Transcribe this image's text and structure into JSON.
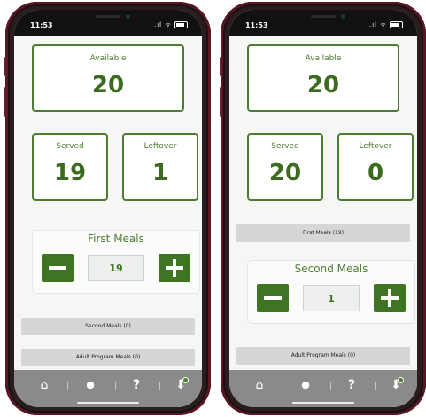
{
  "status_bar": {
    "time": "11:53",
    "signal": ".ıl",
    "wifi": "ᯤ"
  },
  "left_phone": {
    "available": {
      "label": "Available",
      "value": "20"
    },
    "served": {
      "label": "Served",
      "value": "19"
    },
    "leftover": {
      "label": "Leftover",
      "value": "1"
    },
    "meal_stepper": {
      "title": "First Meals",
      "count": "19",
      "minus": "−",
      "plus": "+"
    },
    "bars": [
      "Second Meals (0)",
      "Adult Program Meals (0)"
    ]
  },
  "right_phone": {
    "available": {
      "label": "Available",
      "value": "20"
    },
    "served": {
      "label": "Served",
      "value": "20"
    },
    "leftover": {
      "label": "Leftover",
      "value": "0"
    },
    "top_bar": "First Meals (19)",
    "meal_stepper": {
      "title": "Second Meals",
      "count": "1",
      "minus": "−",
      "plus": "+"
    },
    "bars": [
      "Adult Program Meals (0)"
    ]
  },
  "tabbar": {
    "icons": [
      "home-icon",
      "user-icon",
      "help-icon",
      "inbox-icon"
    ],
    "glyphs": {
      "home": "⌂",
      "user": "●",
      "help": "?",
      "inbox": "⬇"
    }
  },
  "colors": {
    "accent_green": "#4e7d31",
    "button_green": "#3e7422",
    "tab_gray": "#8a8a8a",
    "frame": "#5a1622"
  }
}
